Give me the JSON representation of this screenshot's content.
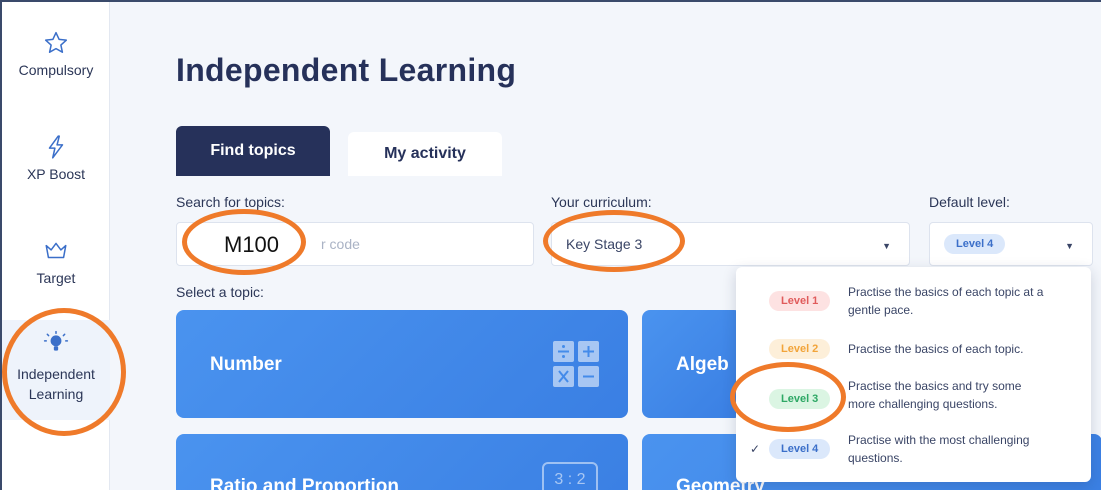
{
  "sidebar": {
    "items": [
      {
        "label": "Compulsory",
        "icon": "star-icon"
      },
      {
        "label": "XP Boost",
        "icon": "lightning-icon"
      },
      {
        "label": "Target",
        "icon": "crown-icon"
      },
      {
        "label": "Independent Learning",
        "icon": "lightbulb-icon",
        "active": true
      }
    ]
  },
  "page": {
    "title": "Independent Learning"
  },
  "tabs": [
    {
      "label": "Find topics",
      "active": true
    },
    {
      "label": "My activity",
      "active": false
    }
  ],
  "search": {
    "label": "Search for topics:",
    "placeholder_visible": "r code",
    "overlay_value": "M100"
  },
  "curriculum": {
    "label": "Your curriculum:",
    "value": "Key Stage 3"
  },
  "default_level": {
    "label": "Default level:",
    "value": "Level 4"
  },
  "select_topic_label": "Select a topic:",
  "topics": [
    {
      "label": "Number"
    },
    {
      "label": "Algeb"
    },
    {
      "label": "Ratio and Proportion"
    },
    {
      "label": "Geometry"
    }
  ],
  "ratio_icon_text": "3 : 2",
  "level_options": [
    {
      "label": "Level 1",
      "desc_line1": "Practise the basics of each topic at a",
      "desc_line2": "gentle pace.",
      "selected": false
    },
    {
      "label": "Level 2",
      "desc_line1": "Practise the basics of each topic.",
      "desc_line2": "",
      "selected": false
    },
    {
      "label": "Level 3",
      "desc_line1": "Practise the basics and try some",
      "desc_line2": "more challenging questions.",
      "selected": false
    },
    {
      "label": "Level 4",
      "desc_line1": "Practise with the most challenging",
      "desc_line2": "questions.",
      "selected": true
    }
  ],
  "colors": {
    "navy": "#26315a",
    "card_blue": "#4a93ef",
    "annotation_orange": "#ef7a2a",
    "level1": "#e05b5b",
    "level2": "#f2a43a",
    "level3": "#2ea865",
    "level4": "#3b6fc9"
  }
}
